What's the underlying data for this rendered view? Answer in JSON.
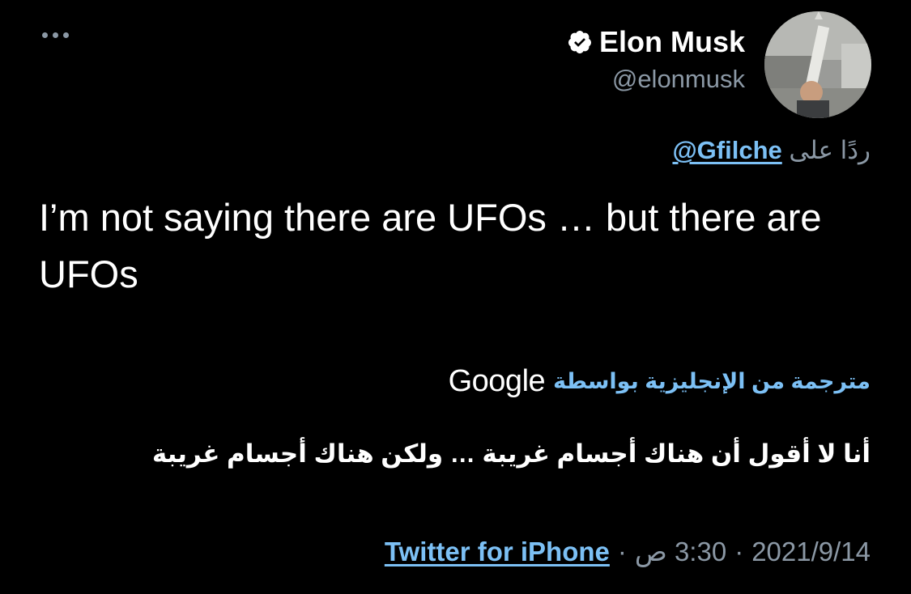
{
  "author": {
    "name": "Elon Musk",
    "handle": "@elonmusk",
    "verified_icon": "verified-badge-icon"
  },
  "header": {
    "more_icon": "more-horizontal-icon"
  },
  "reply": {
    "prefix": "ردًا على",
    "to": "@Gfilche"
  },
  "tweet": {
    "text": "I’m not saying there are UFOs … but there are UFOs"
  },
  "translation": {
    "label": "مترجمة من الإنجليزية بواسطة",
    "provider": "Google",
    "text": "أنا لا أقول أن هناك أجسام غريبة … ولكن هناك أجسام غريبة"
  },
  "meta": {
    "date": "2021/9/14",
    "time": "3:30 ص",
    "separator": "·",
    "source": "Twitter for iPhone"
  },
  "colors": {
    "background": "#000000",
    "link": "#7cc0f5",
    "secondary": "#8b98a5",
    "primary_text": "#ffffff"
  }
}
